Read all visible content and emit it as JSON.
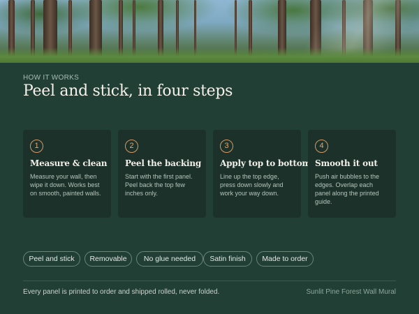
{
  "hero": {
    "image_desc_icon": "forest-banner-image"
  },
  "header": {
    "eyebrow": "HOW IT WORKS",
    "title": "Peel and stick, in four steps"
  },
  "steps": [
    {
      "number": "1",
      "title": "Measure & clean",
      "text": "Measure your wall, then wipe it down. Works best on smooth, painted walls."
    },
    {
      "number": "2",
      "title": "Peel the backing",
      "text": "Start with the first panel. Peel back the top few inches only."
    },
    {
      "number": "3",
      "title": "Apply top to bottom",
      "text": "Line up the top edge, press down slowly and work your way down."
    },
    {
      "number": "4",
      "title": "Smooth it out",
      "text": "Push air bubbles to the edges. Overlap each panel along the printed guide."
    }
  ],
  "tags": [
    "Peel and stick",
    "Removable",
    "No glue needed",
    "Satin finish",
    "Made to order"
  ],
  "footer": {
    "note": "Every panel is printed to order and shipped rolled, never folded.",
    "product": "Sunlit Pine Forest Wall Mural"
  },
  "colors": {
    "background": "#223f36",
    "card": "#1b3129",
    "accent": "#d99a63",
    "tag_border": "#6b8579"
  }
}
